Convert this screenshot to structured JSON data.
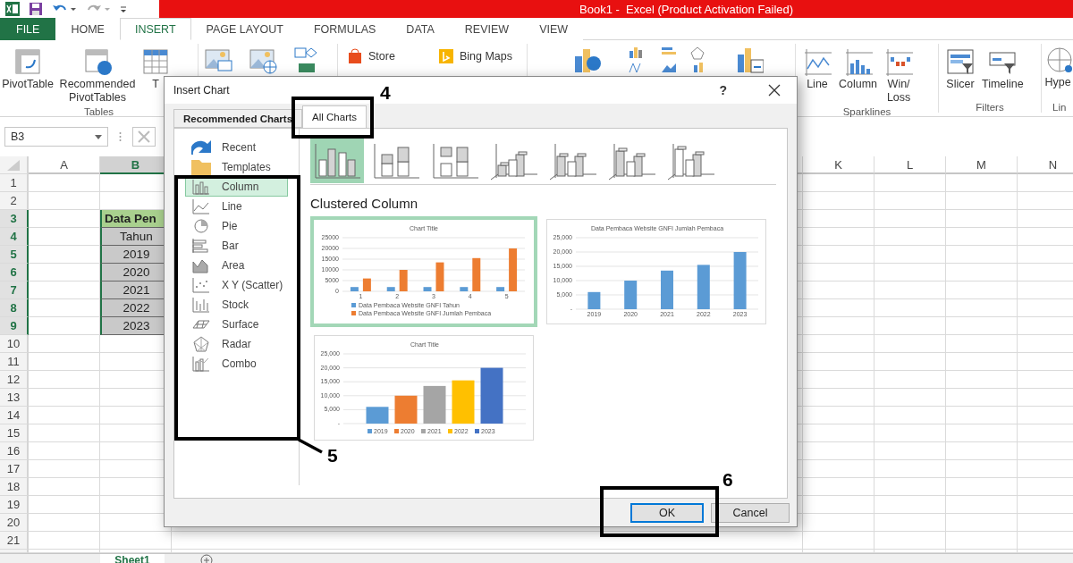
{
  "window": {
    "title": "Book1 -  Excel (Product Activation Failed)"
  },
  "tabs": [
    {
      "label": "FILE",
      "kind": "file",
      "selected": false
    },
    {
      "label": "HOME",
      "kind": "tab",
      "selected": false
    },
    {
      "label": "INSERT",
      "kind": "tab",
      "selected": true
    },
    {
      "label": "PAGE LAYOUT",
      "kind": "tab",
      "selected": false
    },
    {
      "label": "FORMULAS",
      "kind": "tab",
      "selected": false
    },
    {
      "label": "DATA",
      "kind": "tab",
      "selected": false
    },
    {
      "label": "REVIEW",
      "kind": "tab",
      "selected": false
    },
    {
      "label": "VIEW",
      "kind": "tab",
      "selected": false
    }
  ],
  "ribbon": {
    "tables": {
      "buttons": [
        "PivotTable",
        "Recommended PivotTables",
        "T"
      ],
      "label": "Tables"
    },
    "apps": [
      "Store",
      "Bing Maps"
    ],
    "sparklines": {
      "buttons": [
        "Line",
        "Column",
        "Win/\nLoss"
      ],
      "label": "Sparklines"
    },
    "filters": {
      "buttons": [
        "Slicer",
        "Timeline"
      ],
      "label": "Filters"
    },
    "links": {
      "buttons": [
        "Hype"
      ],
      "label": "Lin"
    }
  },
  "name_box": {
    "value": "B3"
  },
  "sheet": {
    "columns_left": [
      {
        "label": "A",
        "selected": false
      },
      {
        "label": "B",
        "selected": true
      }
    ],
    "columns_right": [
      {
        "label": "K",
        "selected": false
      },
      {
        "label": "L",
        "selected": false
      },
      {
        "label": "M",
        "selected": false
      },
      {
        "label": "N",
        "selected": false
      }
    ],
    "rows": [
      {
        "label": "1",
        "selected": false
      },
      {
        "label": "2",
        "selected": false
      },
      {
        "label": "3",
        "selected": true,
        "cell_b": {
          "text": "Data Pen",
          "kind": "title"
        }
      },
      {
        "label": "4",
        "selected": true,
        "cell_b": {
          "text": "Tahun",
          "kind": "data"
        }
      },
      {
        "label": "5",
        "selected": true,
        "cell_b": {
          "text": "2019",
          "kind": "data"
        }
      },
      {
        "label": "6",
        "selected": true,
        "cell_b": {
          "text": "2020",
          "kind": "data"
        }
      },
      {
        "label": "7",
        "selected": true,
        "cell_b": {
          "text": "2021",
          "kind": "data"
        }
      },
      {
        "label": "8",
        "selected": true,
        "cell_b": {
          "text": "2022",
          "kind": "data"
        }
      },
      {
        "label": "9",
        "selected": true,
        "cell_b": {
          "text": "2023",
          "kind": "data"
        }
      },
      {
        "label": "10",
        "selected": false
      },
      {
        "label": "11",
        "selected": false
      },
      {
        "label": "12",
        "selected": false
      },
      {
        "label": "13",
        "selected": false
      },
      {
        "label": "14",
        "selected": false
      },
      {
        "label": "15",
        "selected": false
      },
      {
        "label": "16",
        "selected": false
      },
      {
        "label": "17",
        "selected": false
      },
      {
        "label": "18",
        "selected": false
      },
      {
        "label": "19",
        "selected": false
      },
      {
        "label": "20",
        "selected": false
      },
      {
        "label": "21",
        "selected": false
      }
    ],
    "sheet_tabs": [
      {
        "label": "Sheet1",
        "selected": true
      }
    ]
  },
  "dialog": {
    "title": "Insert Chart",
    "help": "?",
    "tabs": [
      {
        "label": "Recommended Charts",
        "selected": false
      },
      {
        "label": "All Charts",
        "selected": true
      }
    ],
    "chart_types": [
      {
        "label": "Recent",
        "selected": false
      },
      {
        "label": "Templates",
        "selected": false
      },
      {
        "label": "Column",
        "selected": true
      },
      {
        "label": "Line",
        "selected": false
      },
      {
        "label": "Pie",
        "selected": false
      },
      {
        "label": "Bar",
        "selected": false
      },
      {
        "label": "Area",
        "selected": false
      },
      {
        "label": "X Y (Scatter)",
        "selected": false
      },
      {
        "label": "Stock",
        "selected": false
      },
      {
        "label": "Surface",
        "selected": false
      },
      {
        "label": "Radar",
        "selected": false
      },
      {
        "label": "Combo",
        "selected": false
      }
    ],
    "subtypes": [
      {
        "selected": true
      },
      {
        "selected": false
      },
      {
        "selected": false
      },
      {
        "selected": false
      },
      {
        "selected": false
      },
      {
        "selected": false
      },
      {
        "selected": false
      }
    ],
    "subtype_title": "Clustered Column",
    "previews": [
      {
        "selected": true,
        "chart_data": {
          "type": "bar",
          "title": "Chart Title",
          "grid": true,
          "legend": true,
          "categories": [
            "1",
            "2",
            "3",
            "4",
            "5"
          ],
          "ylim": [
            0,
            25000
          ],
          "yticks": [
            0,
            5000,
            10000,
            15000,
            20000,
            25000
          ],
          "series": [
            {
              "name": "Data Pembaca Website GNFI  Tahun",
              "color": "#5b9bd5",
              "values": [
                2000,
                2000,
                2000,
                2000,
                2000
              ]
            },
            {
              "name": "Data Pembaca Website GNFI  Jumlah Pembaca",
              "color": "#ed7d31",
              "values": [
                6000,
                10000,
                13500,
                15500,
                20000
              ]
            }
          ]
        }
      },
      {
        "selected": false,
        "chart_data": {
          "type": "bar",
          "title": "Data Pembaca Website GNFI  Jumlah Pembaca",
          "grid": true,
          "categories": [
            "2019",
            "2020",
            "2021",
            "2022",
            "2023"
          ],
          "ylim": [
            0,
            25000
          ],
          "yticks": [
            {
              "value": 0,
              "label": "-"
            },
            {
              "value": 5000,
              "label": "5,000"
            },
            {
              "value": 10000,
              "label": "10,000"
            },
            {
              "value": 15000,
              "label": "15,000"
            },
            {
              "value": 20000,
              "label": "20,000"
            },
            {
              "value": 25000,
              "label": "25,000"
            }
          ],
          "series": [
            {
              "color": "#5b9bd5",
              "values": [
                6000,
                10000,
                13500,
                15500,
                20000
              ]
            }
          ]
        }
      },
      {
        "selected": false,
        "chart_data": {
          "type": "bar",
          "title": "Chart Title",
          "grid": true,
          "legend": true,
          "ylim": [
            0,
            25000
          ],
          "yticks": [
            {
              "value": 0,
              "label": "-"
            },
            {
              "value": 5000,
              "label": "5,000"
            },
            {
              "value": 10000,
              "label": "10,000"
            },
            {
              "value": 15000,
              "label": "15,000"
            },
            {
              "value": 20000,
              "label": "20,000"
            },
            {
              "value": 25000,
              "label": "25,000"
            }
          ],
          "series": [
            {
              "name": "2019",
              "color": "#5b9bd5",
              "values": [
                6000
              ]
            },
            {
              "name": "2020",
              "color": "#ed7d31",
              "values": [
                10000
              ]
            },
            {
              "name": "2021",
              "color": "#a5a5a5",
              "values": [
                13500
              ]
            },
            {
              "name": "2022",
              "color": "#ffc000",
              "values": [
                15500
              ]
            },
            {
              "name": "2023",
              "color": "#4472c4",
              "values": [
                20000
              ]
            }
          ]
        }
      }
    ],
    "buttons": [
      {
        "label": "OK",
        "kind": "default"
      },
      {
        "label": "Cancel",
        "kind": "normal"
      }
    ]
  },
  "annotations": [
    {
      "number": "4"
    },
    {
      "number": "5"
    },
    {
      "number": "6"
    }
  ]
}
